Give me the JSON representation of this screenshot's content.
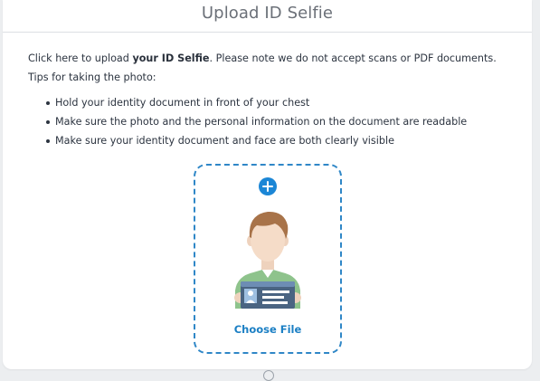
{
  "header": {
    "title": "Upload ID Selfie"
  },
  "instructions": {
    "intro_before": "Click here to upload ",
    "intro_bold": "your ID Selfie",
    "intro_after": ". Please note we do not accept scans or PDF documents. Tips for taking the photo:",
    "tips": [
      "Hold your identity document in front of your chest",
      "Make sure the photo and the personal information on the document are readable",
      "Make sure your identity document and face are both clearly visible"
    ]
  },
  "upload": {
    "choose_label": "Choose File",
    "icon": "plus-circle-icon",
    "accent_color": "#1b86d6"
  }
}
